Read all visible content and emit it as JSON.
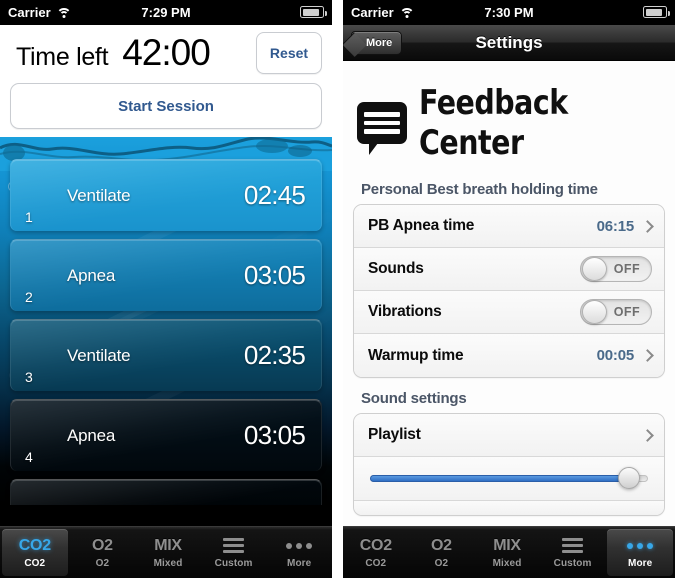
{
  "left_phone": {
    "status_bar": {
      "carrier": "Carrier",
      "wifi_icon": "wifi-icon",
      "time": "7:29 PM",
      "battery_icon": "battery-icon"
    },
    "timer": {
      "label": "Time left",
      "value": "42:00",
      "reset_label": "Reset"
    },
    "start_button": "Start Session",
    "session_rows": [
      {
        "index": "1",
        "name": "Ventilate",
        "time": "02:45"
      },
      {
        "index": "2",
        "name": "Apnea",
        "time": "03:05"
      },
      {
        "index": "3",
        "name": "Ventilate",
        "time": "02:35"
      },
      {
        "index": "4",
        "name": "Apnea",
        "time": "03:05"
      }
    ],
    "tabs": [
      {
        "glyph": "CO2",
        "label": "CO2",
        "icon": "co2-icon",
        "selected": true
      },
      {
        "glyph": "O2",
        "label": "O2",
        "icon": "o2-icon",
        "selected": false
      },
      {
        "glyph": "MIX",
        "label": "Mixed",
        "icon": "mix-icon",
        "selected": false
      },
      {
        "glyph": "",
        "label": "Custom",
        "icon": "bars-icon",
        "selected": false
      },
      {
        "glyph": "",
        "label": "More",
        "icon": "dots-icon",
        "selected": false
      }
    ]
  },
  "right_phone": {
    "status_bar": {
      "carrier": "Carrier",
      "wifi_icon": "wifi-icon",
      "time": "7:30 PM",
      "battery_icon": "battery-icon"
    },
    "navbar": {
      "back_label": "More",
      "title": "Settings"
    },
    "logo": {
      "text": "Feedback Center",
      "icon": "speech-bubble-icon"
    },
    "section_1": {
      "header": "Personal Best breath holding time",
      "rows": [
        {
          "label": "PB Apnea time",
          "value": "06:15",
          "type": "disclosure"
        },
        {
          "label": "Sounds",
          "value": "OFF",
          "type": "toggle"
        },
        {
          "label": "Vibrations",
          "value": "OFF",
          "type": "toggle"
        },
        {
          "label": "Warmup time",
          "value": "00:05",
          "type": "disclosure"
        }
      ]
    },
    "section_2": {
      "header": "Sound settings",
      "rows": [
        {
          "label": "Playlist",
          "value": "",
          "type": "disclosure"
        }
      ],
      "slider": {
        "value_percent": 93
      }
    },
    "tabs": [
      {
        "glyph": "CO2",
        "label": "CO2",
        "icon": "co2-icon",
        "selected": false
      },
      {
        "glyph": "O2",
        "label": "O2",
        "icon": "o2-icon",
        "selected": false
      },
      {
        "glyph": "MIX",
        "label": "Mixed",
        "icon": "mix-icon",
        "selected": false
      },
      {
        "glyph": "",
        "label": "Custom",
        "icon": "bars-icon",
        "selected": false
      },
      {
        "glyph": "",
        "label": "More",
        "icon": "dots-icon",
        "selected": true
      }
    ]
  },
  "colors": {
    "accent_blue": "#37a7e8",
    "link_blue": "#31598f",
    "section_header": "#4b5667",
    "value_blue": "#4a6a8a"
  }
}
